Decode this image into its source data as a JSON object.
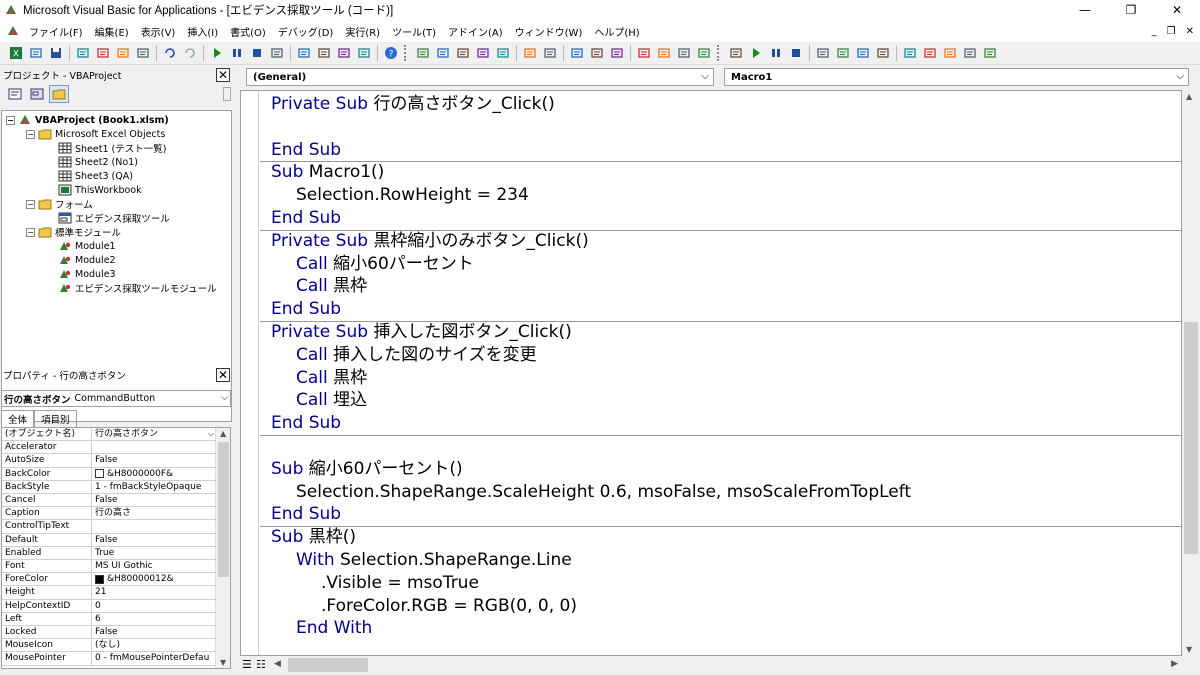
{
  "window": {
    "title": "Microsoft Visual Basic for Applications - [エビデンス採取ツール (コード)]",
    "minimize": "—",
    "restore": "❐",
    "close": "✕"
  },
  "menu": [
    {
      "label": "ファイル(F)",
      "name": "menu-file"
    },
    {
      "label": "編集(E)",
      "name": "menu-edit"
    },
    {
      "label": "表示(V)",
      "name": "menu-view"
    },
    {
      "label": "挿入(I)",
      "name": "menu-insert"
    },
    {
      "label": "書式(O)",
      "name": "menu-format"
    },
    {
      "label": "デバッグ(D)",
      "name": "menu-debug"
    },
    {
      "label": "実行(R)",
      "name": "menu-run"
    },
    {
      "label": "ツール(T)",
      "name": "menu-tools"
    },
    {
      "label": "アドイン(A)",
      "name": "menu-addins"
    },
    {
      "label": "ウィンドウ(W)",
      "name": "menu-window"
    },
    {
      "label": "ヘルプ(H)",
      "name": "menu-help"
    }
  ],
  "mdi": {
    "minimize": "_",
    "restore": "❐",
    "close": "✕"
  },
  "project": {
    "header": "プロジェクト - VBAProject",
    "close": "✕",
    "tree": [
      {
        "label": "VBAProject (Book1.xlsm)",
        "level": 0,
        "type": "project"
      },
      {
        "label": "Microsoft Excel Objects",
        "level": 1,
        "type": "folder"
      },
      {
        "label": "Sheet1 (テスト一覧)",
        "level": 2,
        "type": "sheet"
      },
      {
        "label": "Sheet2 (No1)",
        "level": 2,
        "type": "sheet"
      },
      {
        "label": "Sheet3 (QA)",
        "level": 2,
        "type": "sheet"
      },
      {
        "label": "ThisWorkbook",
        "level": 2,
        "type": "workbook"
      },
      {
        "label": "フォーム",
        "level": 1,
        "type": "folder"
      },
      {
        "label": "エビデンス採取ツール",
        "level": 2,
        "type": "form"
      },
      {
        "label": "標準モジュール",
        "level": 1,
        "type": "folder"
      },
      {
        "label": "Module1",
        "level": 2,
        "type": "module"
      },
      {
        "label": "Module2",
        "level": 2,
        "type": "module"
      },
      {
        "label": "Module3",
        "level": 2,
        "type": "module"
      },
      {
        "label": "エビデンス採取ツールモジュール",
        "level": 2,
        "type": "module"
      }
    ]
  },
  "properties": {
    "header": "プロパティ - 行の高さボタン",
    "close": "✕",
    "object_name": "行の高さボタン",
    "object_type": "CommandButton",
    "tabs": [
      "全体",
      "項目別"
    ],
    "rows": [
      {
        "name": "(オブジェクト名)",
        "value": "行の高さボタン"
      },
      {
        "name": "Accelerator",
        "value": ""
      },
      {
        "name": "AutoSize",
        "value": "False"
      },
      {
        "name": "BackColor",
        "value": "&H8000000F&",
        "swatch": "#ffffff"
      },
      {
        "name": "BackStyle",
        "value": "1 - fmBackStyleOpaque"
      },
      {
        "name": "Cancel",
        "value": "False"
      },
      {
        "name": "Caption",
        "value": "行の高さ"
      },
      {
        "name": "ControlTipText",
        "value": ""
      },
      {
        "name": "Default",
        "value": "False"
      },
      {
        "name": "Enabled",
        "value": "True"
      },
      {
        "name": "Font",
        "value": "MS UI Gothic"
      },
      {
        "name": "ForeColor",
        "value": "&H80000012&",
        "swatch": "#000000"
      },
      {
        "name": "Height",
        "value": "21"
      },
      {
        "name": "HelpContextID",
        "value": "0"
      },
      {
        "name": "Left",
        "value": "6"
      },
      {
        "name": "Locked",
        "value": "False"
      },
      {
        "name": "MouseIcon",
        "value": "(なし)"
      },
      {
        "name": "MousePointer",
        "value": "0 - fmMousePointerDefau"
      }
    ]
  },
  "editor": {
    "object_combo": "(General)",
    "proc_combo": "Macro1",
    "dropdown": "⌵",
    "keyword_color": "#00008b",
    "lines": [
      {
        "indent": 0,
        "parts": [
          {
            "t": "Private Sub ",
            "kw": true
          },
          {
            "t": "行の高さボタン_Click()"
          }
        ]
      },
      {
        "indent": 0,
        "parts": []
      },
      {
        "indent": 0,
        "parts": [
          {
            "t": "End Sub",
            "kw": true
          }
        ],
        "sep_after": true
      },
      {
        "indent": 0,
        "parts": [
          {
            "t": "Sub ",
            "kw": true
          },
          {
            "t": "Macro1()"
          }
        ]
      },
      {
        "indent": 1,
        "parts": [
          {
            "t": "Selection.RowHeight = 234"
          }
        ]
      },
      {
        "indent": 0,
        "parts": [
          {
            "t": "End Sub",
            "kw": true
          }
        ],
        "sep_after": true
      },
      {
        "indent": 0,
        "parts": [
          {
            "t": "Private Sub ",
            "kw": true
          },
          {
            "t": "黒枠縮小のみボタン_Click()"
          }
        ]
      },
      {
        "indent": 1,
        "parts": [
          {
            "t": "Call ",
            "kw": true
          },
          {
            "t": "縮小60パーセント"
          }
        ]
      },
      {
        "indent": 1,
        "parts": [
          {
            "t": "Call ",
            "kw": true
          },
          {
            "t": "黒枠"
          }
        ]
      },
      {
        "indent": 0,
        "parts": [
          {
            "t": "End Sub",
            "kw": true
          }
        ],
        "sep_after": true
      },
      {
        "indent": 0,
        "parts": [
          {
            "t": "Private Sub ",
            "kw": true
          },
          {
            "t": "挿入した図ボタン_Click()"
          }
        ]
      },
      {
        "indent": 1,
        "parts": [
          {
            "t": "Call ",
            "kw": true
          },
          {
            "t": "挿入した図のサイズを変更"
          }
        ]
      },
      {
        "indent": 1,
        "parts": [
          {
            "t": "Call ",
            "kw": true
          },
          {
            "t": "黒枠"
          }
        ]
      },
      {
        "indent": 1,
        "parts": [
          {
            "t": "Call ",
            "kw": true
          },
          {
            "t": "埋込"
          }
        ]
      },
      {
        "indent": 0,
        "parts": [
          {
            "t": "End Sub",
            "kw": true
          }
        ],
        "sep_after": true
      },
      {
        "indent": 0,
        "parts": []
      },
      {
        "indent": 0,
        "parts": [
          {
            "t": "Sub ",
            "kw": true
          },
          {
            "t": "縮小60パーセント()"
          }
        ]
      },
      {
        "indent": 1,
        "parts": [
          {
            "t": "Selection.ShapeRange.ScaleHeight 0.6, msoFalse, msoScaleFromTopLeft"
          }
        ]
      },
      {
        "indent": 0,
        "parts": [
          {
            "t": "End Sub",
            "kw": true
          }
        ],
        "sep_after": true
      },
      {
        "indent": 0,
        "parts": [
          {
            "t": "Sub ",
            "kw": true
          },
          {
            "t": "黒枠()"
          }
        ]
      },
      {
        "indent": 1,
        "parts": [
          {
            "t": "With ",
            "kw": true
          },
          {
            "t": "Selection.ShapeRange.Line"
          }
        ]
      },
      {
        "indent": 2,
        "parts": [
          {
            "t": ".Visible = msoTrue"
          }
        ]
      },
      {
        "indent": 2,
        "parts": [
          {
            "t": ".ForeColor.RGB = RGB(0, 0, 0)"
          }
        ]
      },
      {
        "indent": 1,
        "parts": [
          {
            "t": "End With",
            "kw": true
          }
        ]
      }
    ]
  },
  "toolbar_icons": [
    "excel-icon",
    "insert-userform-icon",
    "save-icon",
    "sep",
    "cut-icon",
    "copy-icon",
    "paste-icon",
    "find-icon",
    "sep",
    "undo-icon",
    "redo-icon",
    "sep",
    "run-icon",
    "break-icon",
    "reset-icon",
    "design-mode-icon",
    "sep",
    "project-explorer-icon",
    "properties-window-icon",
    "object-browser-icon",
    "toolbox-icon",
    "sep",
    "help-icon",
    "grip",
    "list-properties-icon",
    "list-constants-icon",
    "quick-info-icon",
    "parameter-info-icon",
    "complete-word-icon",
    "sep",
    "indent-icon",
    "outdent-icon",
    "sep",
    "toggle-breakpoint-icon",
    "comment-block-icon",
    "uncomment-block-icon",
    "sep",
    "toggle-bookmark-icon",
    "next-bookmark-icon",
    "previous-bookmark-icon",
    "clear-bookmarks-icon",
    "grip",
    "design-mode2-icon",
    "run2-icon",
    "break2-icon",
    "reset2-icon",
    "sep",
    "toggle-breakpoint2-icon",
    "step-into-icon",
    "step-over-icon",
    "step-out-icon",
    "sep",
    "locals-window-icon",
    "immediate-window-icon",
    "watch-window-icon",
    "quick-watch-icon",
    "call-stack-icon"
  ]
}
